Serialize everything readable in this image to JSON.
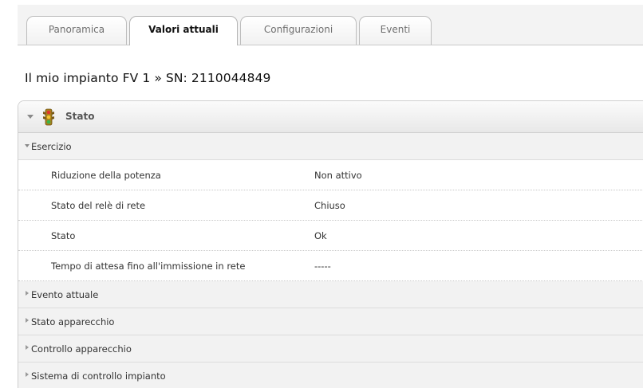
{
  "tabs": [
    {
      "label": "Panoramica",
      "active": false
    },
    {
      "label": "Valori attuali",
      "active": true
    },
    {
      "label": "Configurazioni",
      "active": false
    },
    {
      "label": "Eventi",
      "active": false
    }
  ],
  "page_title": "Il mio impianto FV 1 » SN: 2110044849",
  "panel": {
    "title": "Stato",
    "icon": "traffic-light-icon",
    "expanded_section": {
      "label": "Esercizio",
      "rows": [
        {
          "key": "Riduzione della potenza",
          "value": "Non attivo"
        },
        {
          "key": "Stato del relè di rete",
          "value": "Chiuso"
        },
        {
          "key": "Stato",
          "value": "Ok"
        },
        {
          "key": "Tempo di attesa fino all'immissione in rete",
          "value": "-----"
        }
      ]
    },
    "collapsed_sections": [
      {
        "label": "Evento attuale"
      },
      {
        "label": "Stato apparecchio"
      },
      {
        "label": "Controllo apparecchio"
      },
      {
        "label": "Sistema di controllo impianto"
      }
    ]
  },
  "colors": {
    "tab_bar_bg": "#f3f3f3",
    "section_bg": "#f2f2f2",
    "header_gradient_top": "#fbfbfb",
    "header_gradient_bottom": "#e8e8e8"
  }
}
